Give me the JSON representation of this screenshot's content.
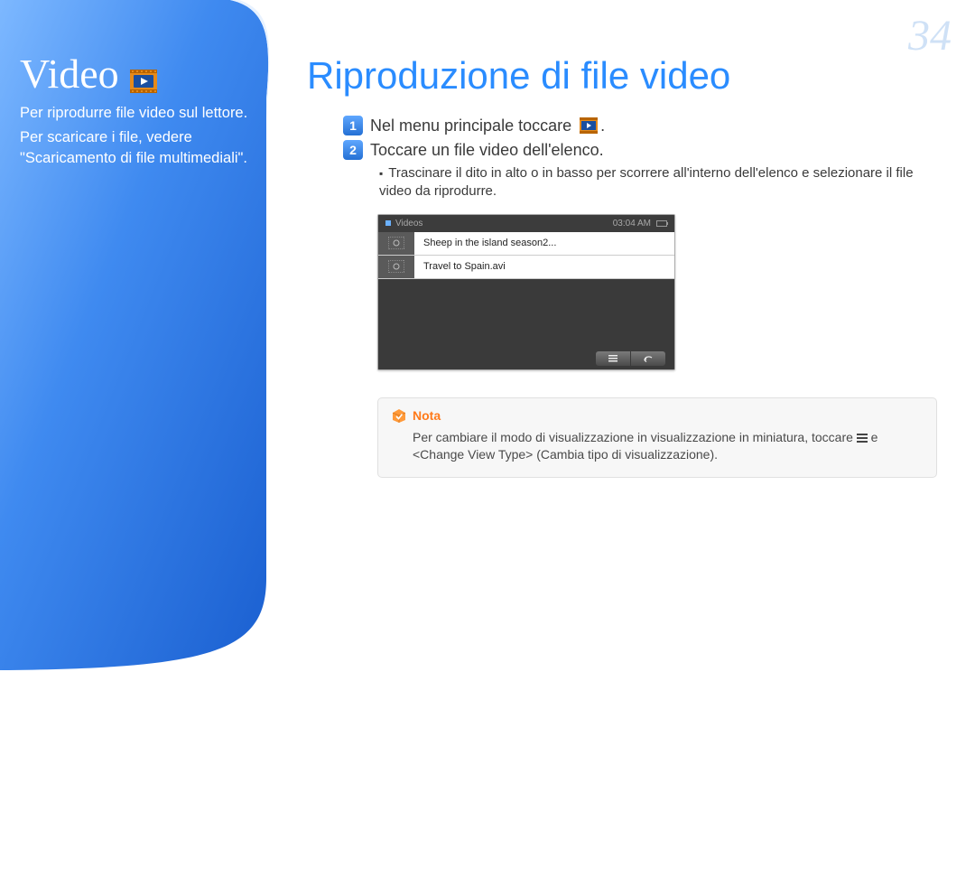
{
  "page_number": "34",
  "sidebar": {
    "title": "Video",
    "subtitle": "Per riprodurre file video sul lettore.",
    "link_text": "Per scaricare i file, vedere \"Scaricamento di file multimediali\"."
  },
  "main": {
    "title": "Riproduzione di file video",
    "step1": {
      "num": "1",
      "text": "Nel menu principale toccare",
      "trail": "."
    },
    "step2": {
      "num": "2",
      "text": "Toccare un file video dell'elenco."
    },
    "substep": "Trascinare il dito in alto o in basso per scorrere all'interno dell'elenco e selezionare il file video da riprodurre."
  },
  "device": {
    "header_title": "Videos",
    "time": "03:04 AM",
    "rows": [
      "Sheep in the island season2...",
      "Travel to Spain.avi"
    ]
  },
  "note": {
    "label": "Nota",
    "body_pre": "Per cambiare il modo di visualizzazione in visualizzazione in miniatura, toccare ",
    "body_post": " e <Change View Type> (Cambia tipo di visualizzazione)."
  }
}
